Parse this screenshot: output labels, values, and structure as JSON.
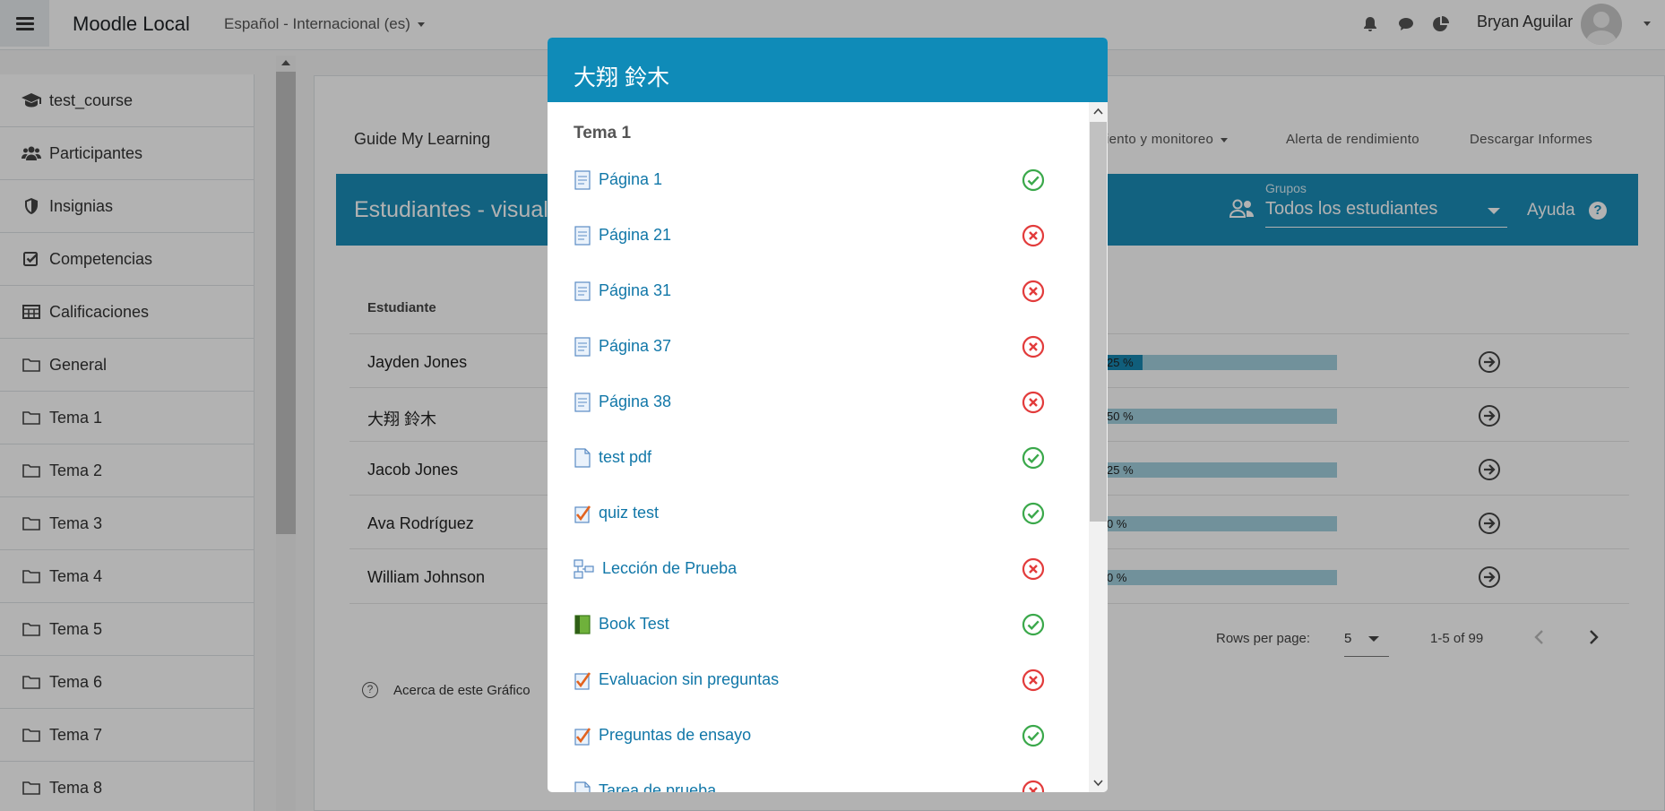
{
  "navbar": {
    "site_name": "Moodle Local",
    "language": "Español - Internacional (es)",
    "user_name": "Bryan Aguilar"
  },
  "drawer": {
    "items": [
      {
        "label": "test_course",
        "icon": "graduation-cap-icon"
      },
      {
        "label": "Participantes",
        "icon": "users-icon"
      },
      {
        "label": "Insignias",
        "icon": "shield-icon"
      },
      {
        "label": "Competencias",
        "icon": "checkbox-icon"
      },
      {
        "label": "Calificaciones",
        "icon": "table-icon"
      },
      {
        "label": "General",
        "icon": "folder-icon"
      },
      {
        "label": "Tema 1",
        "icon": "folder-icon"
      },
      {
        "label": "Tema 2",
        "icon": "folder-icon"
      },
      {
        "label": "Tema 3",
        "icon": "folder-icon"
      },
      {
        "label": "Tema 4",
        "icon": "folder-icon"
      },
      {
        "label": "Tema 5",
        "icon": "folder-icon"
      },
      {
        "label": "Tema 6",
        "icon": "folder-icon"
      },
      {
        "label": "Tema 7",
        "icon": "folder-icon"
      },
      {
        "label": "Tema 8",
        "icon": "folder-icon"
      }
    ]
  },
  "main": {
    "guide_title": "Guide My Learning",
    "links": {
      "tracking_partial": "iento y monitoreo",
      "performance_alert": "Alerta de rendimiento",
      "download_reports": "Descargar Informes"
    },
    "header_title_partial": "Estudiantes - visuali",
    "groups_label": "Grupos",
    "groups_value": "Todos los estudiantes",
    "help_label": "Ayuda",
    "table_header_student": "Estudiante",
    "students": [
      {
        "name": "Jayden Jones",
        "progress_text": "25 %",
        "progress": 0.25
      },
      {
        "name": "大翔 鈴木",
        "progress_text": "50 %",
        "progress": 0.5
      },
      {
        "name": "Jacob Jones",
        "progress_text": "25 %",
        "progress": 0.25
      },
      {
        "name": "Ava Rodríguez",
        "progress_text": "0 %",
        "progress": 0
      },
      {
        "name": "William Johnson",
        "progress_text": "0 %",
        "progress": 0
      }
    ],
    "rows_per_page_label": "Rows per page:",
    "rows_per_page_value": "5",
    "range_text": "1-5 of 99",
    "about_label": "Acerca de este Gráfico"
  },
  "modal": {
    "title": "大翔 鈴木",
    "section": "Tema 1",
    "activities": [
      {
        "label": "Página 1",
        "type": "page",
        "completed": true
      },
      {
        "label": "Página 21",
        "type": "page",
        "completed": false
      },
      {
        "label": "Página 31",
        "type": "page",
        "completed": false
      },
      {
        "label": "Página 37",
        "type": "page",
        "completed": false
      },
      {
        "label": "Página 38",
        "type": "page",
        "completed": false
      },
      {
        "label": "test pdf",
        "type": "file",
        "completed": true
      },
      {
        "label": "quiz test",
        "type": "quiz",
        "completed": true
      },
      {
        "label": "Lección de Prueba",
        "type": "lesson",
        "completed": false
      },
      {
        "label": "Book Test",
        "type": "book",
        "completed": true
      },
      {
        "label": "Evaluacion sin preguntas",
        "type": "quiz",
        "completed": false
      },
      {
        "label": "Preguntas de ensayo",
        "type": "quiz",
        "completed": true
      },
      {
        "label": "Tarea de prueba",
        "type": "file",
        "completed": false
      }
    ]
  },
  "colors": {
    "teal": "#1a8db8",
    "link": "#1177a8",
    "success": "#3aa84a",
    "danger": "#e23b3b"
  }
}
